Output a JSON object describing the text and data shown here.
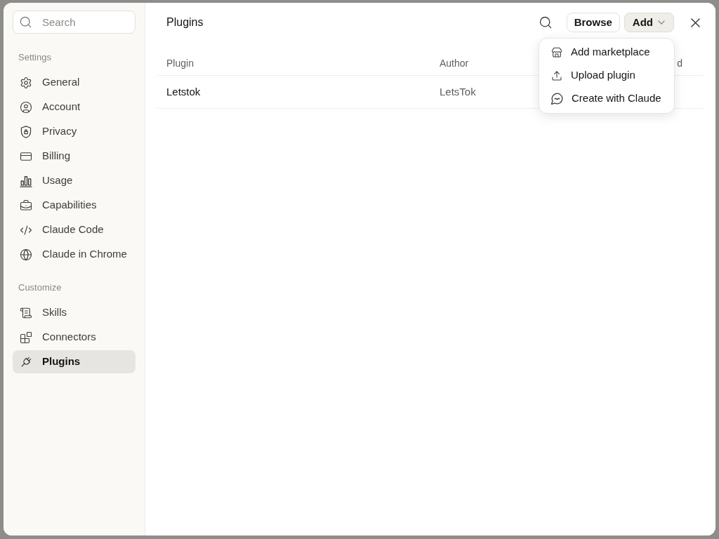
{
  "sidebar": {
    "search": {
      "placeholder": "Search"
    },
    "sections": [
      {
        "title": "Settings",
        "items": [
          {
            "label": "General",
            "selected": false
          },
          {
            "label": "Account",
            "selected": false
          },
          {
            "label": "Privacy",
            "selected": false
          },
          {
            "label": "Billing",
            "selected": false
          },
          {
            "label": "Usage",
            "selected": false
          },
          {
            "label": "Capabilities",
            "selected": false
          },
          {
            "label": "Claude Code",
            "selected": false
          },
          {
            "label": "Claude in Chrome",
            "selected": false
          }
        ]
      },
      {
        "title": "Customize",
        "items": [
          {
            "label": "Skills",
            "selected": false
          },
          {
            "label": "Connectors",
            "selected": false
          },
          {
            "label": "Plugins",
            "selected": true
          }
        ]
      }
    ]
  },
  "header": {
    "title": "Plugins",
    "buttons": [
      {
        "label": "Browse",
        "kind": "plain"
      },
      {
        "label": "Add",
        "kind": "dropdown",
        "expanded": true,
        "menu": [
          {
            "label": "Add marketplace"
          },
          {
            "label": "Upload plugin"
          },
          {
            "label": "Create with Claude"
          }
        ]
      }
    ]
  },
  "table": {
    "columns": [
      "Plugin",
      "Author",
      "d"
    ],
    "rows": [
      {
        "cells": [
          "Letstok",
          "LetsTok"
        ]
      }
    ]
  }
}
